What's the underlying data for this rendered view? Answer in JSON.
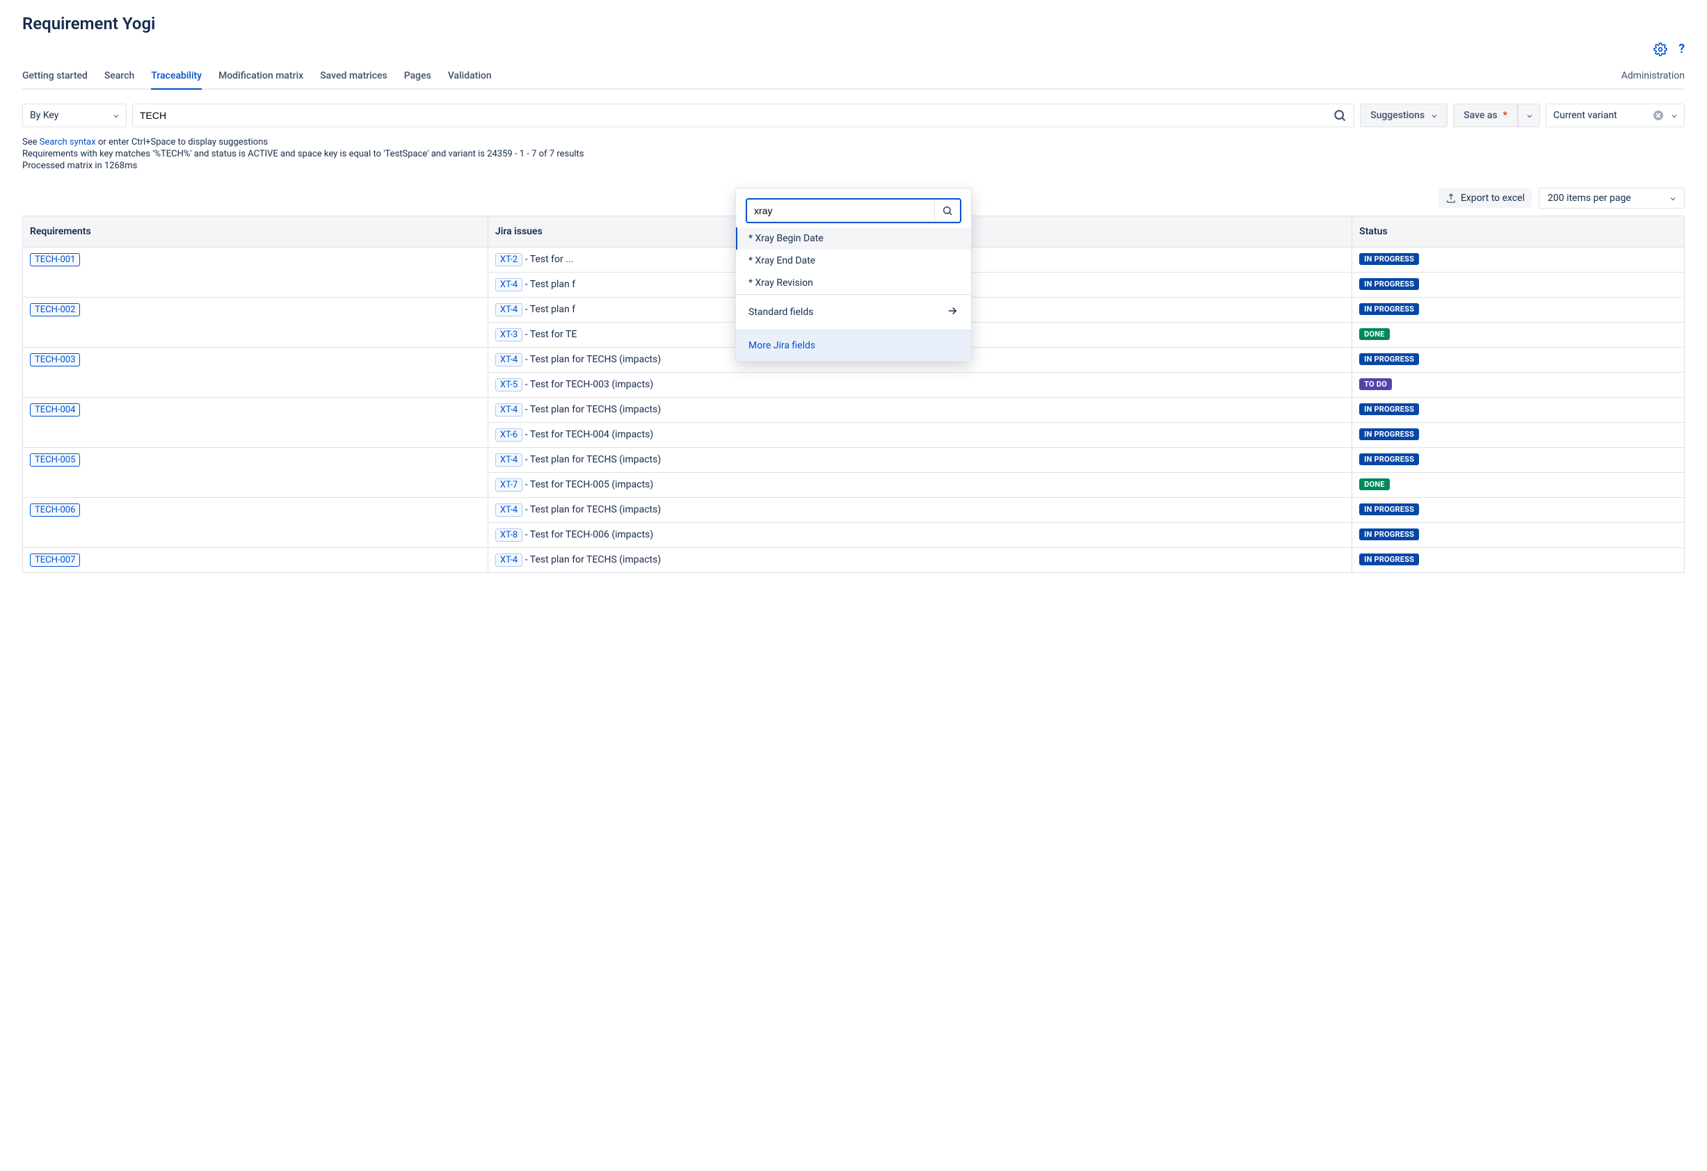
{
  "page_title": "Requirement Yogi",
  "tabs": [
    {
      "label": "Getting started",
      "active": false
    },
    {
      "label": "Search",
      "active": false
    },
    {
      "label": "Traceability",
      "active": true
    },
    {
      "label": "Modification matrix",
      "active": false
    },
    {
      "label": "Saved matrices",
      "active": false
    },
    {
      "label": "Pages",
      "active": false
    },
    {
      "label": "Validation",
      "active": false
    }
  ],
  "admin_link": "Administration",
  "controls": {
    "search_mode": "By Key",
    "search_value": "TECH",
    "suggestions_label": "Suggestions",
    "save_as_label": "Save as",
    "variant_label": "Current variant"
  },
  "info": {
    "prefix": "See ",
    "link": "Search syntax",
    "suffix": " or enter Ctrl+Space to display suggestions",
    "query_summary": "Requirements with key matches '%TECH%' and status is ACTIVE and space key is equal to 'TestSpace' and variant is 24359 - 1 - 7 of 7 results",
    "processed": "Processed matrix in 1268ms"
  },
  "popover": {
    "filter_value": "xray",
    "items": [
      {
        "label": "* Xray Begin Date",
        "selected": true
      },
      {
        "label": "* Xray End Date",
        "selected": false
      },
      {
        "label": "* Xray Revision",
        "selected": false
      }
    ],
    "sections": [
      {
        "label": "Standard fields",
        "arrow": true,
        "more": false
      },
      {
        "label": "More Jira fields",
        "arrow": false,
        "more": true
      }
    ]
  },
  "actions": {
    "export_label": "Export to excel",
    "page_size": "200 items per page"
  },
  "table": {
    "headers": [
      "Requirements",
      "Jira issues",
      "",
      "Status"
    ],
    "rows": [
      {
        "req": "TECH-001",
        "issues": [
          {
            "key": "XT-2",
            "text": " - Test for ...",
            "status": "IN PROGRESS",
            "status_class": "inprogress"
          },
          {
            "key": "XT-4",
            "text": " - Test plan f",
            "status": "IN PROGRESS",
            "status_class": "inprogress"
          }
        ]
      },
      {
        "req": "TECH-002",
        "issues": [
          {
            "key": "XT-4",
            "text": " - Test plan f",
            "status": "IN PROGRESS",
            "status_class": "inprogress"
          },
          {
            "key": "XT-3",
            "text": " - Test for TE",
            "status": "DONE",
            "status_class": "done"
          }
        ]
      },
      {
        "req": "TECH-003",
        "issues": [
          {
            "key": "XT-4",
            "text": " - Test plan for TECHS  (impacts)",
            "status": "IN PROGRESS",
            "status_class": "inprogress"
          },
          {
            "key": "XT-5",
            "text": " - Test for TECH-003  (impacts)",
            "status": "TO DO",
            "status_class": "todo"
          }
        ]
      },
      {
        "req": "TECH-004",
        "issues": [
          {
            "key": "XT-4",
            "text": " - Test plan for TECHS  (impacts)",
            "status": "IN PROGRESS",
            "status_class": "inprogress"
          },
          {
            "key": "XT-6",
            "text": " - Test for TECH-004  (impacts)",
            "status": "IN PROGRESS",
            "status_class": "inprogress"
          }
        ]
      },
      {
        "req": "TECH-005",
        "issues": [
          {
            "key": "XT-4",
            "text": " - Test plan for TECHS  (impacts)",
            "status": "IN PROGRESS",
            "status_class": "inprogress"
          },
          {
            "key": "XT-7",
            "text": " - Test for TECH-005  (impacts)",
            "status": "DONE",
            "status_class": "done"
          }
        ]
      },
      {
        "req": "TECH-006",
        "issues": [
          {
            "key": "XT-4",
            "text": " - Test plan for TECHS  (impacts)",
            "status": "IN PROGRESS",
            "status_class": "inprogress"
          },
          {
            "key": "XT-8",
            "text": " - Test for TECH-006  (impacts)",
            "status": "IN PROGRESS",
            "status_class": "inprogress"
          }
        ]
      },
      {
        "req": "TECH-007",
        "issues": [
          {
            "key": "XT-4",
            "text": " - Test plan for TECHS  (impacts)",
            "status": "IN PROGRESS",
            "status_class": "inprogress"
          }
        ]
      }
    ]
  }
}
